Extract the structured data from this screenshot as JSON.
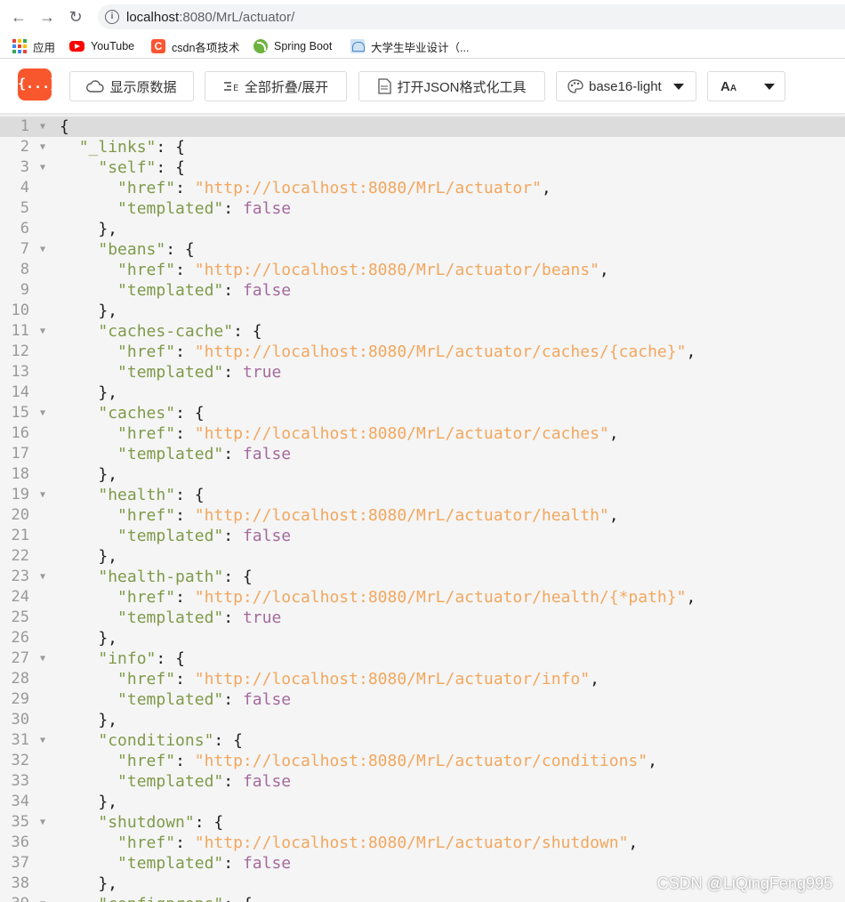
{
  "browser": {
    "url_host": "localhost",
    "url_path": ":8080/MrL/actuator/",
    "bookmarks": [
      {
        "label": "应用",
        "icon": "apps-grid-icon"
      },
      {
        "label": "YouTube",
        "icon": "youtube-icon"
      },
      {
        "label": "csdn各项技术",
        "icon": "csdn-icon"
      },
      {
        "label": "Spring Boot",
        "icon": "spring-icon"
      },
      {
        "label": "大学生毕业设计（...",
        "icon": "university-icon"
      }
    ]
  },
  "toolbar": {
    "logo_text": "{...}",
    "show_raw": "显示原数据",
    "fold_toggle": "全部折叠/展开",
    "open_formatter": "打开JSON格式化工具",
    "theme": "base16-light",
    "font_size_label": "A"
  },
  "code_lines": [
    {
      "n": "1",
      "fold": true,
      "html": "<span class=\"p\">{</span>"
    },
    {
      "n": "2",
      "fold": true,
      "html": "  <span class=\"k\">\"_links\"</span>: {"
    },
    {
      "n": "3",
      "fold": true,
      "html": "    <span class=\"k\">\"self\"</span>: {"
    },
    {
      "n": "4",
      "fold": false,
      "html": "      <span class=\"k\">\"href\"</span>: <span class=\"s\">\"http://localhost:8080/MrL/actuator\"</span>,"
    },
    {
      "n": "5",
      "fold": false,
      "html": "      <span class=\"k\">\"templated\"</span>: <span class=\"b\">false</span>"
    },
    {
      "n": "6",
      "fold": false,
      "html": "    },"
    },
    {
      "n": "7",
      "fold": true,
      "html": "    <span class=\"k\">\"beans\"</span>: {"
    },
    {
      "n": "8",
      "fold": false,
      "html": "      <span class=\"k\">\"href\"</span>: <span class=\"s\">\"http://localhost:8080/MrL/actuator/beans\"</span>,"
    },
    {
      "n": "9",
      "fold": false,
      "html": "      <span class=\"k\">\"templated\"</span>: <span class=\"b\">false</span>"
    },
    {
      "n": "10",
      "fold": false,
      "html": "    },"
    },
    {
      "n": "11",
      "fold": true,
      "html": "    <span class=\"k\">\"caches-cache\"</span>: {"
    },
    {
      "n": "12",
      "fold": false,
      "html": "      <span class=\"k\">\"href\"</span>: <span class=\"s\">\"http://localhost:8080/MrL/actuator/caches/{cache}\"</span>,"
    },
    {
      "n": "13",
      "fold": false,
      "html": "      <span class=\"k\">\"templated\"</span>: <span class=\"b\">true</span>"
    },
    {
      "n": "14",
      "fold": false,
      "html": "    },"
    },
    {
      "n": "15",
      "fold": true,
      "html": "    <span class=\"k\">\"caches\"</span>: {"
    },
    {
      "n": "16",
      "fold": false,
      "html": "      <span class=\"k\">\"href\"</span>: <span class=\"s\">\"http://localhost:8080/MrL/actuator/caches\"</span>,"
    },
    {
      "n": "17",
      "fold": false,
      "html": "      <span class=\"k\">\"templated\"</span>: <span class=\"b\">false</span>"
    },
    {
      "n": "18",
      "fold": false,
      "html": "    },"
    },
    {
      "n": "19",
      "fold": true,
      "html": "    <span class=\"k\">\"health\"</span>: {"
    },
    {
      "n": "20",
      "fold": false,
      "html": "      <span class=\"k\">\"href\"</span>: <span class=\"s\">\"http://localhost:8080/MrL/actuator/health\"</span>,"
    },
    {
      "n": "21",
      "fold": false,
      "html": "      <span class=\"k\">\"templated\"</span>: <span class=\"b\">false</span>"
    },
    {
      "n": "22",
      "fold": false,
      "html": "    },"
    },
    {
      "n": "23",
      "fold": true,
      "html": "    <span class=\"k\">\"health-path\"</span>: {"
    },
    {
      "n": "24",
      "fold": false,
      "html": "      <span class=\"k\">\"href\"</span>: <span class=\"s\">\"http://localhost:8080/MrL/actuator/health/{*path}\"</span>,"
    },
    {
      "n": "25",
      "fold": false,
      "html": "      <span class=\"k\">\"templated\"</span>: <span class=\"b\">true</span>"
    },
    {
      "n": "26",
      "fold": false,
      "html": "    },"
    },
    {
      "n": "27",
      "fold": true,
      "html": "    <span class=\"k\">\"info\"</span>: {"
    },
    {
      "n": "28",
      "fold": false,
      "html": "      <span class=\"k\">\"href\"</span>: <span class=\"s\">\"http://localhost:8080/MrL/actuator/info\"</span>,"
    },
    {
      "n": "29",
      "fold": false,
      "html": "      <span class=\"k\">\"templated\"</span>: <span class=\"b\">false</span>"
    },
    {
      "n": "30",
      "fold": false,
      "html": "    },"
    },
    {
      "n": "31",
      "fold": true,
      "html": "    <span class=\"k\">\"conditions\"</span>: {"
    },
    {
      "n": "32",
      "fold": false,
      "html": "      <span class=\"k\">\"href\"</span>: <span class=\"s\">\"http://localhost:8080/MrL/actuator/conditions\"</span>,"
    },
    {
      "n": "33",
      "fold": false,
      "html": "      <span class=\"k\">\"templated\"</span>: <span class=\"b\">false</span>"
    },
    {
      "n": "34",
      "fold": false,
      "html": "    },"
    },
    {
      "n": "35",
      "fold": true,
      "html": "    <span class=\"k\">\"shutdown\"</span>: {"
    },
    {
      "n": "36",
      "fold": false,
      "html": "      <span class=\"k\">\"href\"</span>: <span class=\"s\">\"http://localhost:8080/MrL/actuator/shutdown\"</span>,"
    },
    {
      "n": "37",
      "fold": false,
      "html": "      <span class=\"k\">\"templated\"</span>: <span class=\"b\">false</span>"
    },
    {
      "n": "38",
      "fold": false,
      "html": "    },"
    },
    {
      "n": "39",
      "fold": true,
      "html": "    <span class=\"k\">\"configprops\"</span>: {"
    }
  ],
  "watermark": "CSDN @LiQingFeng995",
  "colors": {
    "logo": "#f8562d",
    "json_key": "#7f9a4a",
    "json_string": "#f2a75e",
    "json_boolean": "#a46a9e"
  }
}
